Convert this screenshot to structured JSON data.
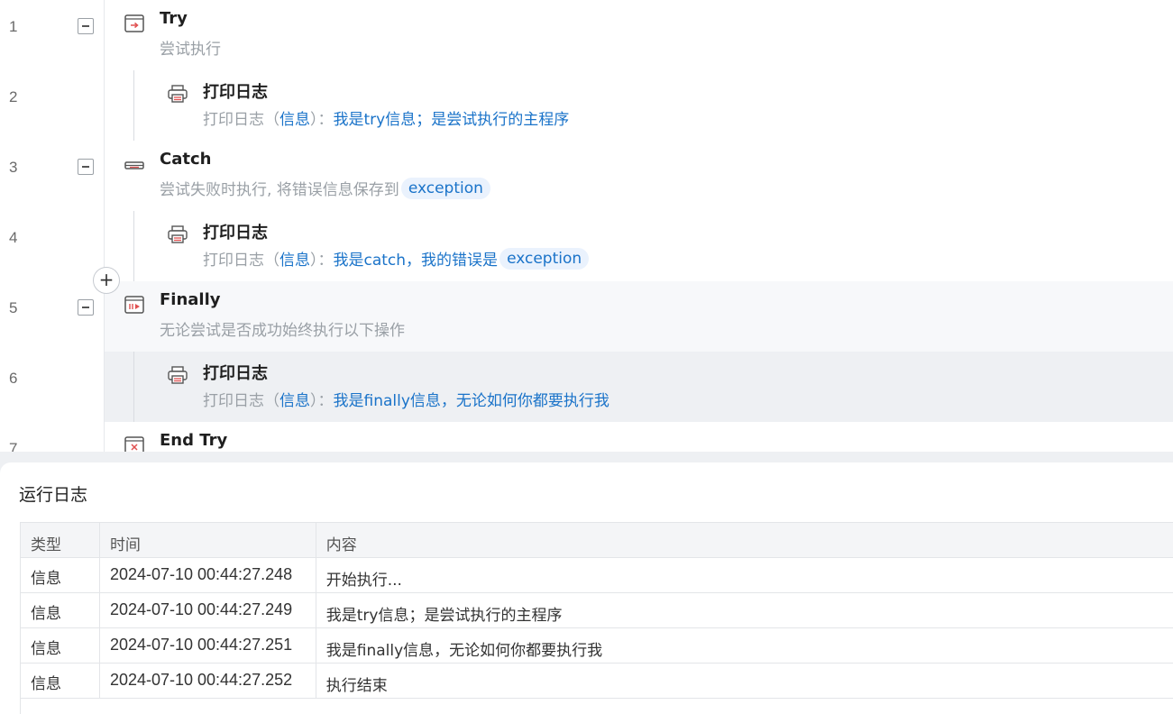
{
  "flow": {
    "steps": [
      {
        "line": "1",
        "title": "Try",
        "desc": "尝试执行"
      },
      {
        "line": "2",
        "title": "打印日志",
        "desc_prefix": "打印日志（",
        "desc_param": "信息",
        "desc_mid": "）：",
        "desc_value": "我是try信息；是尝试执行的主程序"
      },
      {
        "line": "3",
        "title": "Catch",
        "desc": "尝试失败时执行, 将错误信息保存到",
        "desc_chip": "exception"
      },
      {
        "line": "4",
        "title": "打印日志",
        "desc_prefix": "打印日志（",
        "desc_param": "信息",
        "desc_mid": "）：",
        "desc_value": "我是catch，我的错误是",
        "desc_chip": "exception"
      },
      {
        "line": "5",
        "title": "Finally",
        "desc": "无论尝试是否成功始终执行以下操作"
      },
      {
        "line": "6",
        "title": "打印日志",
        "desc_prefix": "打印日志（",
        "desc_param": "信息",
        "desc_mid": "）：",
        "desc_value": "我是finally信息，无论如何你都要执行我"
      },
      {
        "line": "7",
        "title": "End Try"
      }
    ],
    "add_button": "+"
  },
  "log": {
    "title": "运行日志",
    "columns": [
      "类型",
      "时间",
      "内容"
    ],
    "rows": [
      {
        "type": "信息",
        "time": "2024-07-10 00:44:27.248",
        "content": "开始执行..."
      },
      {
        "type": "信息",
        "time": "2024-07-10 00:44:27.249",
        "content": "我是try信息；是尝试执行的主程序"
      },
      {
        "type": "信息",
        "time": "2024-07-10 00:44:27.251",
        "content": "我是finally信息，无论如何你都要执行我"
      },
      {
        "type": "信息",
        "time": "2024-07-10 00:44:27.252",
        "content": "执行结束"
      }
    ]
  },
  "colors": {
    "accent": "#1a73c9",
    "chip_bg": "#eaf2fd",
    "icon_red": "#e05050",
    "muted_text": "#9aa0a6"
  },
  "icons": {
    "try": "try-block-icon",
    "log": "printer-icon",
    "catch": "catch-block-icon",
    "finally": "finally-block-icon",
    "end_try": "end-try-icon",
    "collapse": "collapse-minus-icon",
    "add": "add-plus-icon"
  }
}
